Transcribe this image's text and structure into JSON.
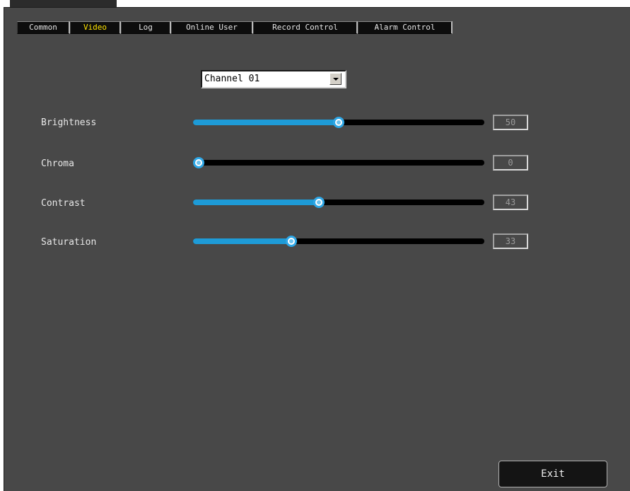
{
  "tabs": {
    "common": "Common",
    "video": "Video",
    "log": "Log",
    "online_user": "Online User",
    "record_control": "Record Control",
    "alarm_control": "Alarm Control",
    "active": "Video"
  },
  "channel_select": {
    "value": "Channel 01"
  },
  "sliders": [
    {
      "label": "Brightness",
      "value": "50",
      "level": 0.5
    },
    {
      "label": "Chroma",
      "value": "0",
      "level": 0.0
    },
    {
      "label": "Contrast",
      "value": "43",
      "level": 0.43
    },
    {
      "label": "Saturation",
      "value": "33",
      "level": 0.33
    }
  ],
  "footer": {
    "exit_label": "Exit"
  },
  "colors": {
    "panel_background": "#484848",
    "slider_fill": "#1e9bd7",
    "active_tab_text": "#ffe400"
  },
  "icons": {
    "dropdown": "chevron-down-icon",
    "slider_handle": "circle-knob-icon"
  }
}
